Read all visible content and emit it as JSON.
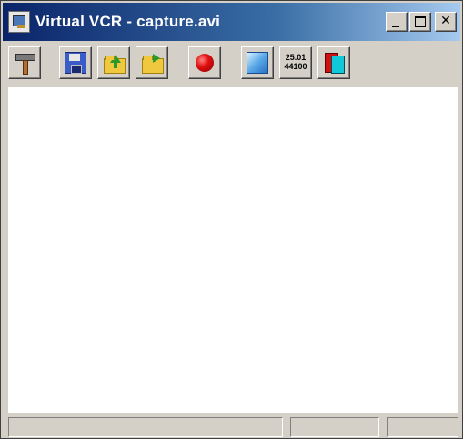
{
  "window": {
    "title": "Virtual VCR - capture.avi",
    "minimize_icon": "minimize-icon",
    "maximize_icon": "maximize-icon",
    "close_label": "✕"
  },
  "toolbar": {
    "buttons": [
      {
        "name": "settings",
        "icon": "hammer-icon"
      },
      {
        "name": "save",
        "icon": "floppy-disk-icon"
      },
      {
        "name": "open",
        "icon": "folder-open-icon"
      },
      {
        "name": "export",
        "icon": "folder-arrow-icon"
      },
      {
        "name": "record",
        "icon": "record-icon"
      },
      {
        "name": "capture-window",
        "icon": "screen-icon"
      },
      {
        "name": "frame-rate",
        "icon": "rate-icon"
      },
      {
        "name": "color-format",
        "icon": "colors-icon"
      }
    ],
    "rate": {
      "fps": "25.01",
      "audio": "44100"
    }
  },
  "statusbar": {
    "pane1": "",
    "pane2": "",
    "pane3": ""
  },
  "colors": {
    "titlebar_start": "#0a246a",
    "titlebar_end": "#a6caf0",
    "face": "#d4d0c8",
    "record": "#e01010"
  }
}
